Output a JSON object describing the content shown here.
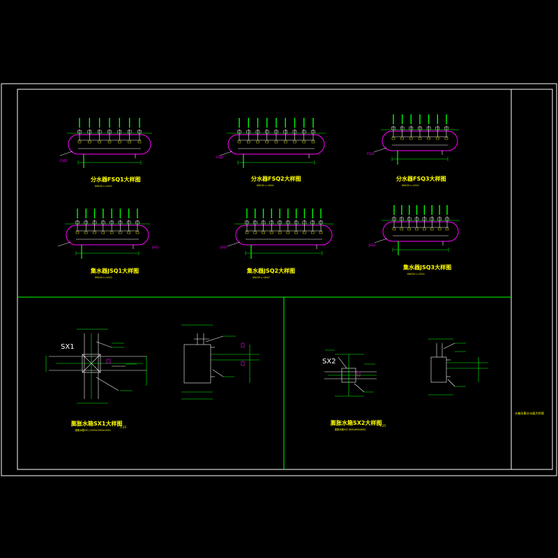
{
  "colors": {
    "background": "#000000",
    "frame": "#ffffff",
    "title": "#ffff00",
    "pipe": "#ff00ff",
    "dim": "#00ff00",
    "divider": "#00ff00"
  },
  "sheet_title": "水箱及集分水器大样图",
  "manifolds": [
    {
      "title": "分水器FSQ1大样图",
      "subtitle": "DN150 L=1410",
      "tag": "FSQ1",
      "outlets": 7
    },
    {
      "title": "分水器FSQ2大样图",
      "subtitle": "DN150 L=1610",
      "tag": "FSQ2",
      "outlets": 9
    },
    {
      "title": "分水器FSQ3大样图",
      "subtitle": "DN150 L=1310",
      "tag": "FSQ3",
      "outlets": 7
    },
    {
      "title": "集水器JSQ1大样图",
      "subtitle": "DN150 L=1410",
      "tag": "JSQ1",
      "outlets": 8
    },
    {
      "title": "集水器JSQ2大样图",
      "subtitle": "DN150 L=1610",
      "tag": "JSQ2",
      "outlets": 10
    },
    {
      "title": "集水器JSQ3大样图",
      "subtitle": "DN150 L=1310",
      "tag": "JSQ3",
      "outlets": 8
    }
  ],
  "tanks": [
    {
      "title": "膨胀水箱SX1大样图",
      "scale": "1:25",
      "subtitle": "膨胀水箱SX1 (1200x1200x1200)",
      "tag": "SX1"
    },
    {
      "title": "膨胀水箱SX2大样图",
      "scale": "1:25",
      "subtitle": "膨胀水箱SX2 (800x800x800)",
      "tag": "SX2"
    }
  ]
}
